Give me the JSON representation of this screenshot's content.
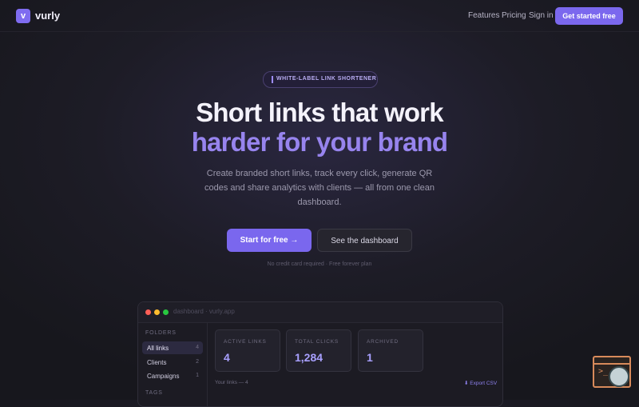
{
  "nav": {
    "logo_letter": "v",
    "brand": "vurly",
    "links": [
      "Features",
      "Pricing",
      "Sign in"
    ],
    "cta": "Get started free"
  },
  "hero": {
    "badge": "WHITE-LABEL LINK SHORTENER",
    "title_line1": "Short links that work",
    "title_line2": "harder for your brand",
    "subtitle": "Create branded short links, track every click, generate QR codes and share analytics with clients — all from one clean dashboard.",
    "primary_button": "Start for free →",
    "secondary_button": "See the dashboard",
    "note": "No credit card required · Free forever plan"
  },
  "dashboard": {
    "url": "dashboard · vurly.app",
    "sidebar": {
      "folders_heading": "FOLDERS",
      "items": [
        {
          "label": "All links",
          "count": "4"
        },
        {
          "label": "Clients",
          "count": "2"
        },
        {
          "label": "Campaigns",
          "count": "1"
        }
      ],
      "tags_heading": "TAGS"
    },
    "stats": [
      {
        "label": "ACTIVE LINKS",
        "value": "4"
      },
      {
        "label": "TOTAL CLICKS",
        "value": "1,284"
      },
      {
        "label": "ARCHIVED",
        "value": "1"
      }
    ],
    "links_summary": "Your links — 4",
    "export": "⬇ Export CSV"
  },
  "widget": {
    "glyph": ">_"
  },
  "colors": {
    "accent": "#7b68ee",
    "accent_text": "#9784ee",
    "background": "#1d1c26",
    "window_dot_red": "#ff5f57",
    "window_dot_yellow": "#febc2e",
    "window_dot_green": "#28c840"
  }
}
